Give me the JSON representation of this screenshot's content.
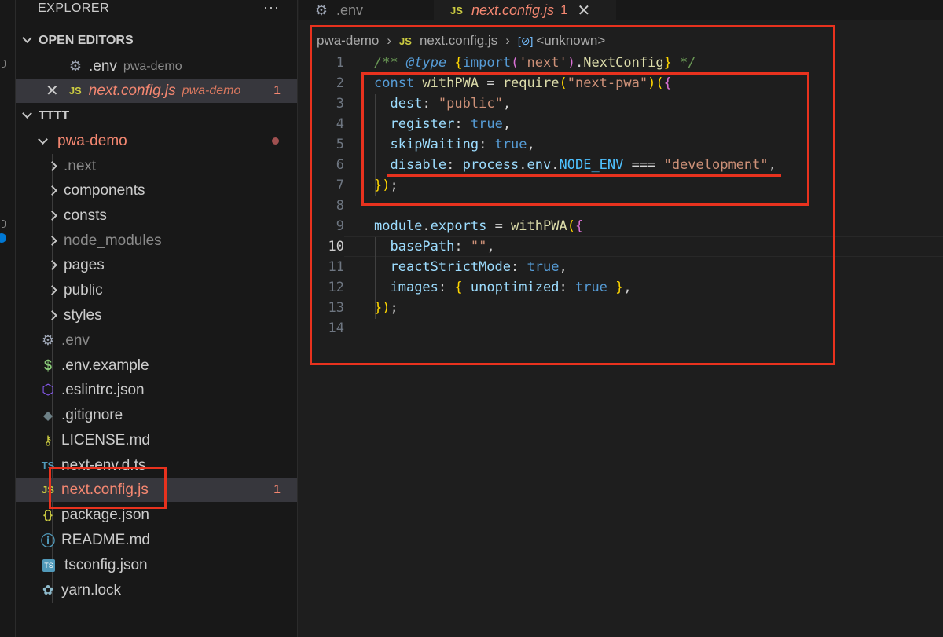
{
  "sidebar": {
    "header": "EXPLORER",
    "more_icon": "ellipsis-icon",
    "open_editors": {
      "title": "OPEN EDITORS",
      "items": [
        {
          "icon": "gear-icon",
          "label": ".env",
          "folder": "pwa-demo",
          "badge": ""
        },
        {
          "icon": "js-icon",
          "label": "next.config.js",
          "folder": "pwa-demo",
          "badge": "1"
        }
      ]
    },
    "workspace": {
      "title": "TTTT",
      "folder": "pwa-demo",
      "folders": [
        ".next",
        "components",
        "consts",
        "node_modules",
        "pages",
        "public",
        "styles"
      ],
      "files": [
        {
          "icon": "gear-icon",
          "label": ".env"
        },
        {
          "icon": "dollar-icon",
          "label": ".env.example"
        },
        {
          "icon": "eslint-icon",
          "label": ".eslintrc.json"
        },
        {
          "icon": "git-icon",
          "label": ".gitignore"
        },
        {
          "icon": "license-icon",
          "label": "LICENSE.md"
        },
        {
          "icon": "typescript-icon",
          "label": "next-env.d.ts"
        },
        {
          "icon": "js-icon",
          "label": "next.config.js",
          "badge": "1"
        },
        {
          "icon": "json-icon",
          "label": "package.json"
        },
        {
          "icon": "info-icon",
          "label": "README.md"
        },
        {
          "icon": "tsconfig-icon",
          "label": "tsconfig.json"
        },
        {
          "icon": "yarn-icon",
          "label": "yarn.lock"
        }
      ]
    }
  },
  "tabs": [
    {
      "icon": "gear-icon",
      "label": ".env",
      "active": false
    },
    {
      "icon": "js-icon",
      "label": "next.config.js",
      "badge": "1",
      "active": true
    }
  ],
  "breadcrumb": {
    "folder": "pwa-demo",
    "file": "next.config.js",
    "symbol": "<unknown>"
  },
  "editor": {
    "active_line": 10,
    "line_numbers": [
      "1",
      "2",
      "3",
      "4",
      "5",
      "6",
      "7",
      "8",
      "9",
      "10",
      "11",
      "12",
      "13",
      "14"
    ],
    "lines": [
      "/** @type {import('next').NextConfig} */",
      "const withPWA = require(\"next-pwa\")({",
      "  dest: \"public\",",
      "  register: true,",
      "  skipWaiting: true,",
      "  disable: process.env.NODE_ENV === \"development\",",
      "});",
      "",
      "module.exports = withPWA({",
      "  basePath: \"\",",
      "  reactStrictMode: true,",
      "  images: { unoptimized: true },",
      "});",
      ""
    ]
  },
  "colors": {
    "annotation_red": "#e8321e",
    "error_text": "#f48771",
    "keyword": "#569cd6",
    "string": "#ce9178"
  }
}
